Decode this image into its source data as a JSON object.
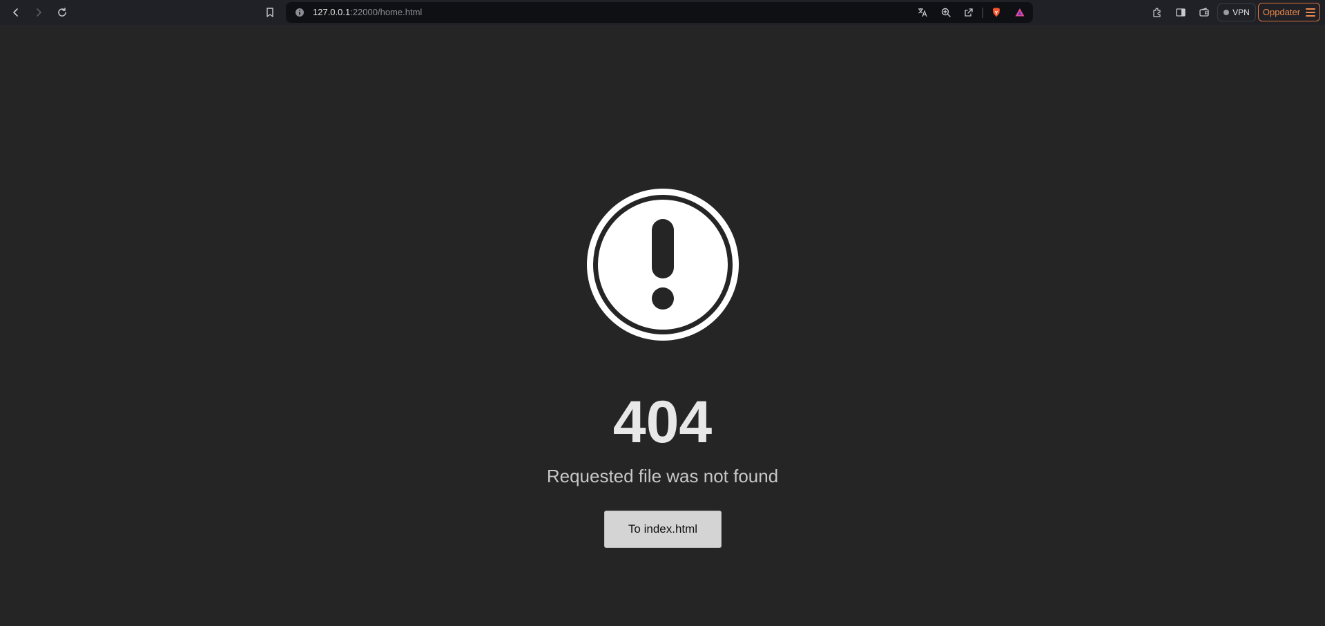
{
  "browser": {
    "url_host": "127.0.0.1",
    "url_rest": ":22000/home.html",
    "vpn_label": "VPN",
    "update_label": "Oppdater",
    "icons": [
      "back-icon",
      "forward-icon",
      "reload-icon",
      "bookmark-icon",
      "site-info-icon",
      "translate-icon",
      "zoom-icon",
      "share-icon",
      "brave-shields-icon",
      "brave-rewards-icon",
      "extensions-icon",
      "sidebar-icon",
      "wallet-icon",
      "menu-icon"
    ],
    "accent_color": "#f08a4b"
  },
  "page": {
    "background": "#252525",
    "error_code": "404",
    "message": "Requested file was not found",
    "button_label": "To index.html",
    "icon": "exclamation-circle-icon"
  }
}
